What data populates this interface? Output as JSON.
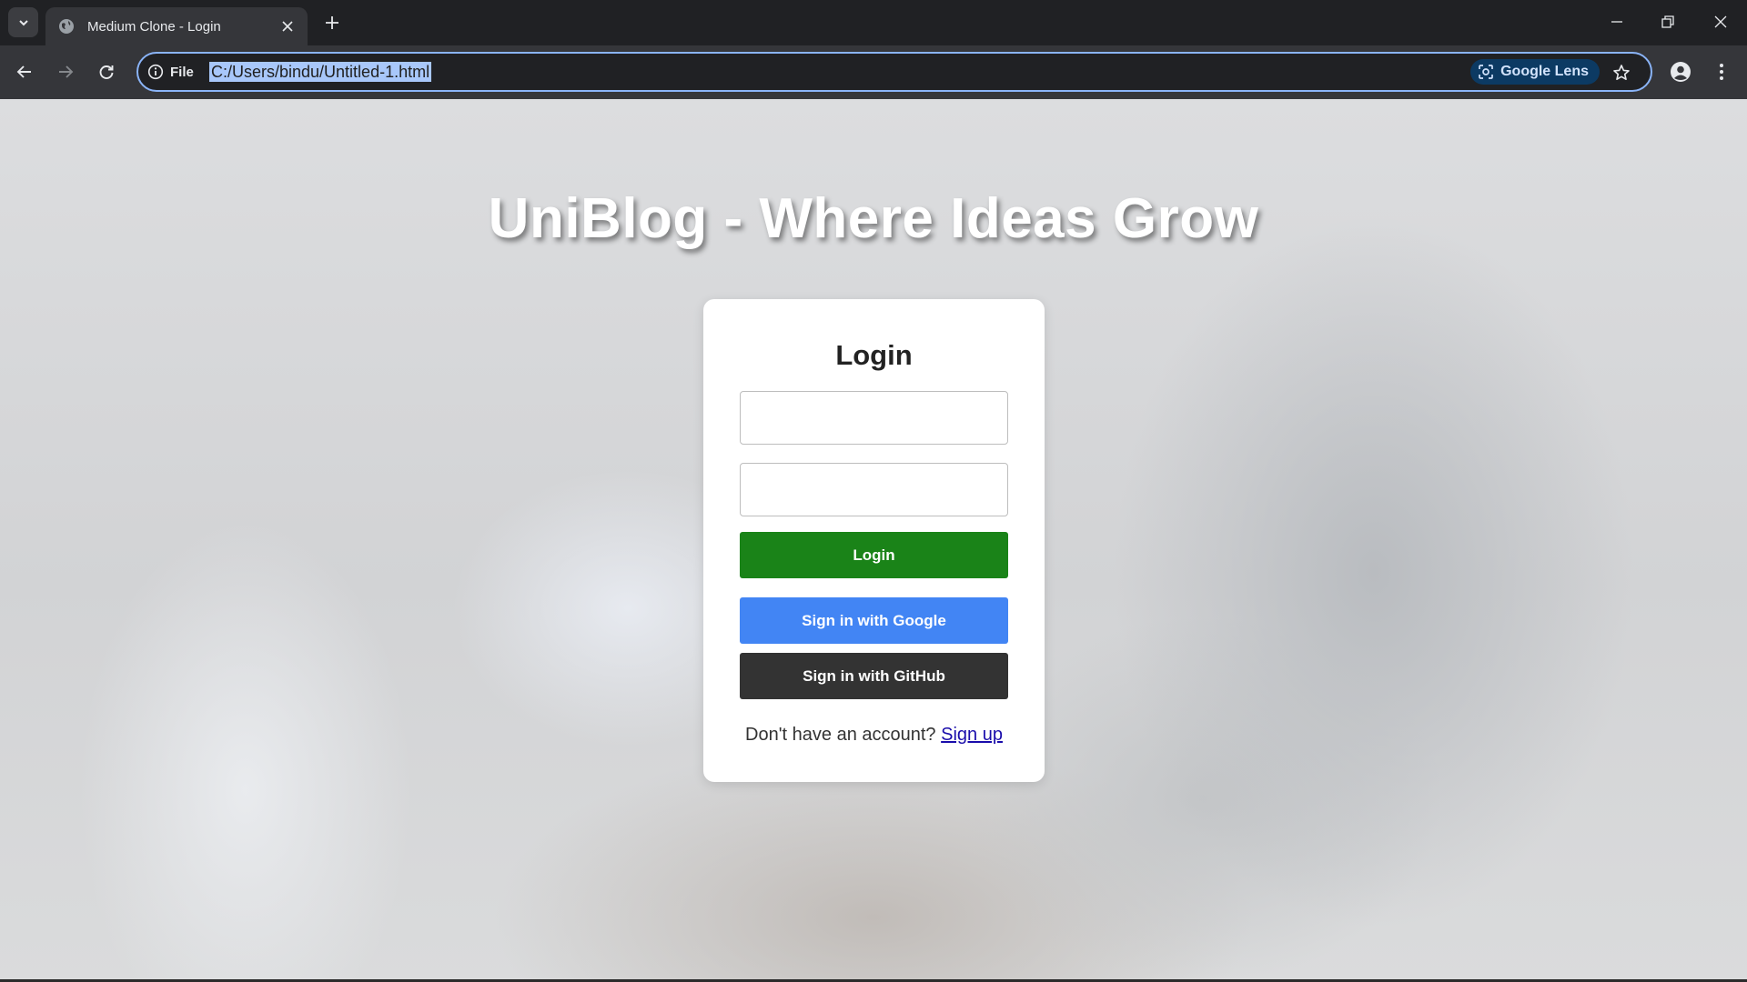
{
  "browser": {
    "tab": {
      "title": "Medium Clone - Login"
    },
    "address_bar": {
      "site_chip": "File",
      "url": "C:/Users/bindu/Untitled-1.html",
      "lens_label": "Google Lens"
    },
    "accent": "#8ab4f8"
  },
  "page": {
    "hero_title": "UniBlog - Where Ideas Grow",
    "login_card": {
      "title": "Login",
      "username": {
        "value": "",
        "placeholder": ""
      },
      "password": {
        "value": "",
        "placeholder": ""
      },
      "login_button": "Login",
      "google_button": "Sign in with Google",
      "github_button": "Sign in with GitHub",
      "signup_prompt": "Don't have an account?",
      "signup_link": "Sign up"
    },
    "colors": {
      "login_button": "#1a8318",
      "google_button": "#4285f4",
      "github_button": "#333333",
      "link": "#1a0dab"
    }
  }
}
